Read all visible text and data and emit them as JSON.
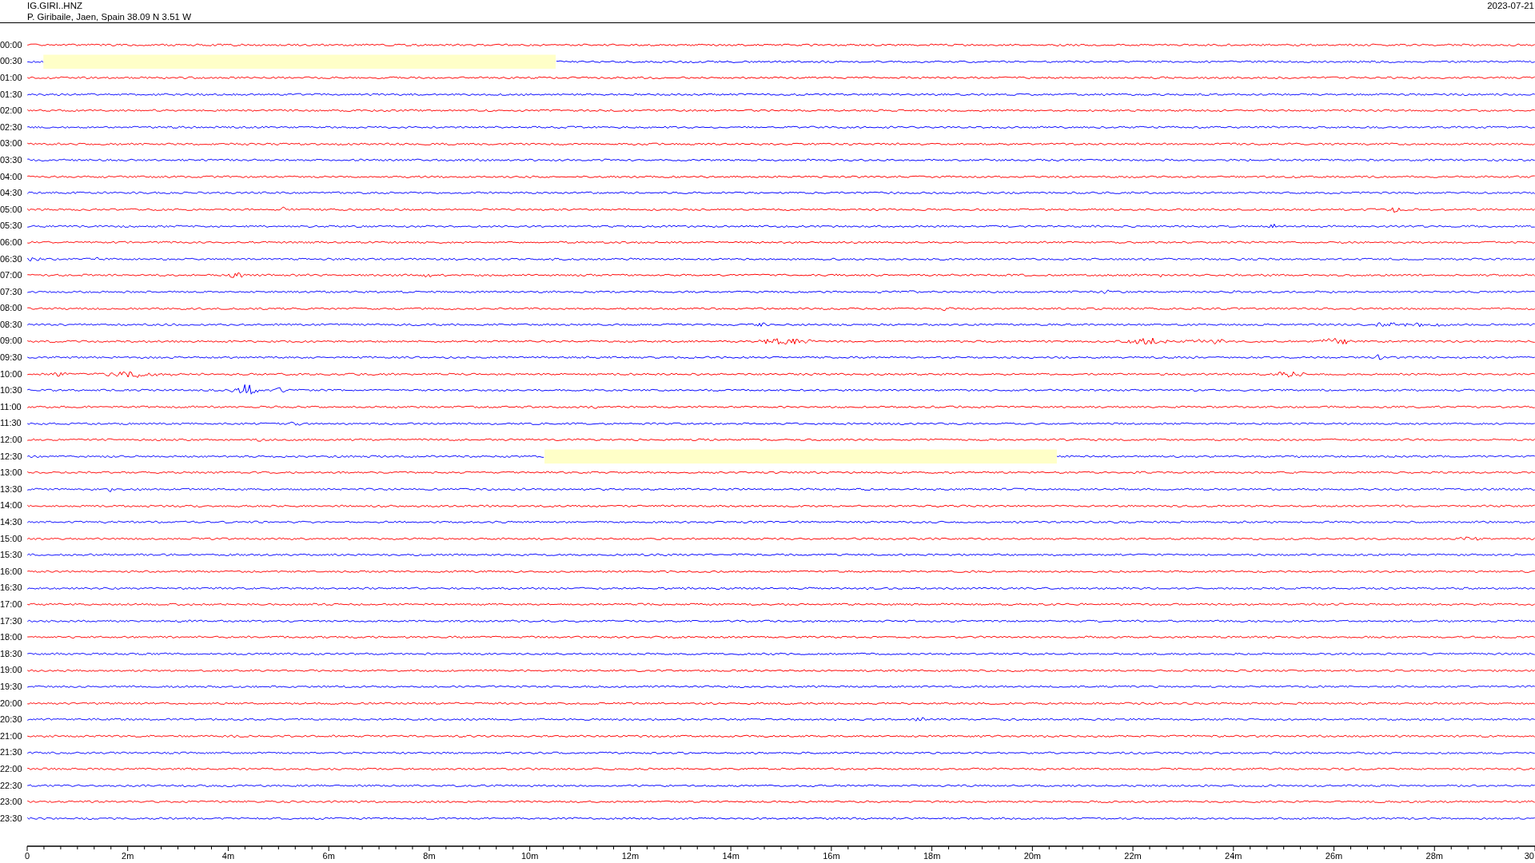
{
  "header": {
    "station": "IG.GIRI..HNZ",
    "location": "P. Giribaile, Jaen, Spain  38.09 N 3.51 W",
    "date": "2023-07-21"
  },
  "rows": [
    {
      "time": "00:00",
      "color": "#ff0000"
    },
    {
      "time": "00:30",
      "color": "#0000ff"
    },
    {
      "time": "01:00",
      "color": "#ff0000"
    },
    {
      "time": "01:30",
      "color": "#0000ff"
    },
    {
      "time": "02:00",
      "color": "#ff0000"
    },
    {
      "time": "02:30",
      "color": "#0000ff"
    },
    {
      "time": "03:00",
      "color": "#ff0000"
    },
    {
      "time": "03:30",
      "color": "#0000ff"
    },
    {
      "time": "04:00",
      "color": "#ff0000"
    },
    {
      "time": "04:30",
      "color": "#0000ff"
    },
    {
      "time": "05:00",
      "color": "#ff0000"
    },
    {
      "time": "05:30",
      "color": "#0000ff"
    },
    {
      "time": "06:00",
      "color": "#ff0000"
    },
    {
      "time": "06:30",
      "color": "#0000ff"
    },
    {
      "time": "07:00",
      "color": "#ff0000"
    },
    {
      "time": "07:30",
      "color": "#0000ff"
    },
    {
      "time": "08:00",
      "color": "#ff0000"
    },
    {
      "time": "08:30",
      "color": "#0000ff"
    },
    {
      "time": "09:00",
      "color": "#ff0000"
    },
    {
      "time": "09:30",
      "color": "#0000ff"
    },
    {
      "time": "10:00",
      "color": "#ff0000"
    },
    {
      "time": "10:30",
      "color": "#0000ff"
    },
    {
      "time": "11:00",
      "color": "#ff0000"
    },
    {
      "time": "11:30",
      "color": "#0000ff"
    },
    {
      "time": "12:00",
      "color": "#ff0000"
    },
    {
      "time": "12:30",
      "color": "#0000ff"
    },
    {
      "time": "13:00",
      "color": "#ff0000"
    },
    {
      "time": "13:30",
      "color": "#0000ff"
    },
    {
      "time": "14:00",
      "color": "#ff0000"
    },
    {
      "time": "14:30",
      "color": "#0000ff"
    },
    {
      "time": "15:00",
      "color": "#ff0000"
    },
    {
      "time": "15:30",
      "color": "#0000ff"
    },
    {
      "time": "16:00",
      "color": "#ff0000"
    },
    {
      "time": "16:30",
      "color": "#0000ff"
    },
    {
      "time": "17:00",
      "color": "#ff0000"
    },
    {
      "time": "17:30",
      "color": "#0000ff"
    },
    {
      "time": "18:00",
      "color": "#ff0000"
    },
    {
      "time": "18:30",
      "color": "#0000ff"
    },
    {
      "time": "19:00",
      "color": "#ff0000"
    },
    {
      "time": "19:30",
      "color": "#0000ff"
    },
    {
      "time": "20:00",
      "color": "#ff0000"
    },
    {
      "time": "20:30",
      "color": "#0000ff"
    },
    {
      "time": "21:00",
      "color": "#ff0000"
    },
    {
      "time": "21:30",
      "color": "#0000ff"
    },
    {
      "time": "22:00",
      "color": "#ff0000"
    },
    {
      "time": "22:30",
      "color": "#0000ff"
    },
    {
      "time": "23:00",
      "color": "#ff0000"
    },
    {
      "time": "23:30",
      "color": "#0000ff"
    }
  ],
  "x_axis": {
    "ticks": [
      "0",
      "2m",
      "4m",
      "6m",
      "8m",
      "10m",
      "12m",
      "14m",
      "16m",
      "18m",
      "20m",
      "22m",
      "24m",
      "26m",
      "28m",
      "30"
    ]
  }
}
